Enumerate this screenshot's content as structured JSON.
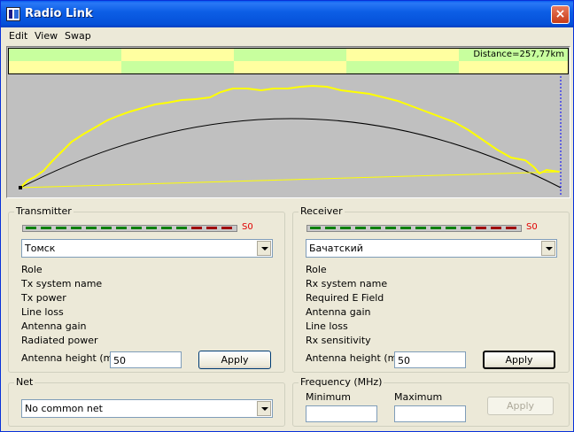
{
  "window": {
    "title": "Radio Link",
    "close_glyph": "×"
  },
  "menu": [
    "Edit",
    "View",
    "Swap"
  ],
  "profile": {
    "distance": "Distance=257,77km",
    "colors": {
      "band_green": "#c8ff9e",
      "band_yellow": "#ffffa0",
      "terrain": "#ffff00",
      "background": "#c0c0c0"
    }
  },
  "transmitter": {
    "title": "Transmitter",
    "signal": "S0",
    "station": "Томск",
    "fields": [
      "Role",
      "Tx system name",
      "Tx power",
      "Line loss",
      "Antenna gain",
      "Radiated power"
    ],
    "antenna_label": "Antenna height (m)",
    "antenna_value": "50",
    "apply_label": "Apply"
  },
  "receiver": {
    "title": "Receiver",
    "signal": "S0",
    "station": "Бачатский",
    "fields": [
      "Role",
      "Rx system name",
      "Required E Field",
      "Antenna gain",
      "Line loss",
      "Rx sensitivity"
    ],
    "antenna_label": "Antenna height (m)",
    "antenna_value": "50",
    "apply_label": "Apply"
  },
  "net": {
    "title": "Net",
    "selected": "No common net"
  },
  "frequency": {
    "title": "Frequency (MHz)",
    "min_label": "Minimum",
    "max_label": "Maximum",
    "min_value": "",
    "max_value": "",
    "apply_label": "Apply"
  }
}
